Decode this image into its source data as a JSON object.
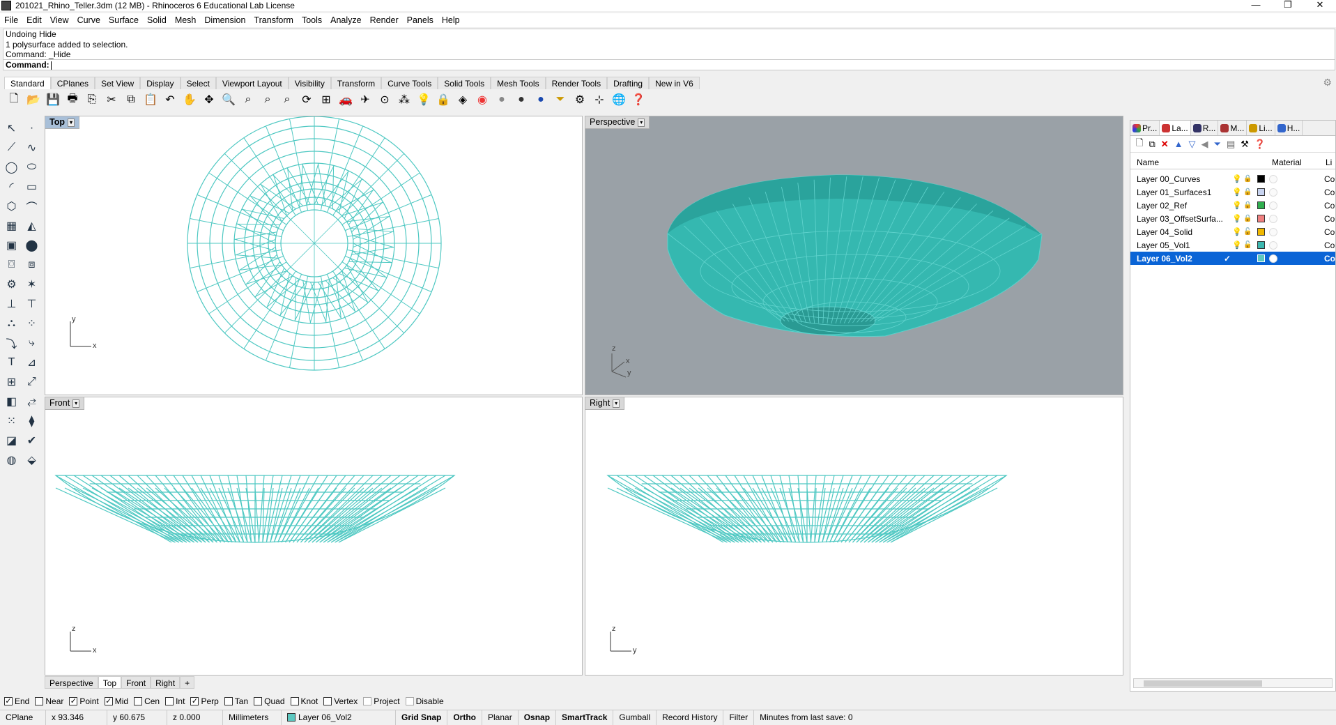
{
  "window": {
    "title": "201021_Rhino_Teller.3dm (12 MB) - Rhinoceros 6 Educational Lab License",
    "buttons": [
      "—",
      "❐",
      "✕"
    ]
  },
  "menu": [
    "File",
    "Edit",
    "View",
    "Curve",
    "Surface",
    "Solid",
    "Mesh",
    "Dimension",
    "Transform",
    "Tools",
    "Analyze",
    "Render",
    "Panels",
    "Help"
  ],
  "command": {
    "history": [
      "Undoing Hide",
      "1 polysurface added to selection.",
      "Command: _Hide"
    ],
    "prompt": "Command:"
  },
  "toolbar_tabs": [
    "Standard",
    "CPlanes",
    "Set View",
    "Display",
    "Select",
    "Viewport Layout",
    "Visibility",
    "Transform",
    "Curve Tools",
    "Solid Tools",
    "Mesh Tools",
    "Render Tools",
    "Drafting",
    "New in V6"
  ],
  "toolbar_icons": [
    "new-file-icon",
    "open-file-icon",
    "save-icon",
    "print-icon",
    "import-icon",
    "cut-icon",
    "copy-icon",
    "paste-icon",
    "undo-icon",
    "pan-icon",
    "rotate-view-icon",
    "zoom-icon",
    "zoom-window-icon",
    "zoom-extents-icon",
    "zoom-selected-icon",
    "rotate-icon",
    "four-viewports-icon",
    "car-icon",
    "plane-icon",
    "point-icon",
    "object-snap-icon",
    "light-icon",
    "lock-icon",
    "material-icon",
    "color-wheel-icon",
    "shade-icon",
    "render-icon",
    "sphere-icon",
    "filter-icon",
    "gear-icon",
    "grid-icon",
    "globe-icon",
    "help-icon"
  ],
  "viewports": {
    "top": {
      "label": "Top",
      "axis_a": "y",
      "axis_b": "x"
    },
    "perspective": {
      "label": "Perspective",
      "axis_a": "z",
      "axis_b": "x",
      "axis_c": "y"
    },
    "front": {
      "label": "Front",
      "axis_a": "z",
      "axis_b": "x"
    },
    "right": {
      "label": "Right",
      "axis_a": "z",
      "axis_b": "y"
    }
  },
  "viewport_tabs": [
    "Perspective",
    "Top",
    "Front",
    "Right",
    "+"
  ],
  "osnap": [
    {
      "label": "End",
      "checked": true
    },
    {
      "label": "Near",
      "checked": false
    },
    {
      "label": "Point",
      "checked": true
    },
    {
      "label": "Mid",
      "checked": true
    },
    {
      "label": "Cen",
      "checked": false
    },
    {
      "label": "Int",
      "checked": false
    },
    {
      "label": "Perp",
      "checked": true
    },
    {
      "label": "Tan",
      "checked": false
    },
    {
      "label": "Quad",
      "checked": false
    },
    {
      "label": "Knot",
      "checked": false
    },
    {
      "label": "Vertex",
      "checked": false
    },
    {
      "label": "Project",
      "checked": false
    },
    {
      "label": "Disable",
      "checked": false
    }
  ],
  "status": {
    "cplane": "CPlane",
    "x": "x 93.346",
    "y": "y 60.675",
    "z": "z 0.000",
    "units": "Millimeters",
    "layer": "Layer 06_Vol2",
    "grid_snap": "Grid Snap",
    "ortho": "Ortho",
    "planar": "Planar",
    "osnap": "Osnap",
    "smarttrack": "SmartTrack",
    "gumball": "Gumball",
    "record_history": "Record History",
    "filter": "Filter",
    "save_info": "Minutes from last save: 0"
  },
  "panel": {
    "tabs": [
      "Pr...",
      "La...",
      "R...",
      "M...",
      "Li...",
      "H..."
    ],
    "col_name": "Name",
    "col_material": "Material",
    "col_linetype": "Li",
    "layers": [
      {
        "name": "Layer 00_Curves",
        "color": "#000000",
        "linetype": "Co",
        "selected": false
      },
      {
        "name": "Layer 01_Surfaces1",
        "color": "#c8d4f0",
        "linetype": "Co",
        "selected": false
      },
      {
        "name": "Layer 02_Ref",
        "color": "#2fae4e",
        "linetype": "Co",
        "selected": false
      },
      {
        "name": "Layer 03_OffsetSurfa...",
        "color": "#f08080",
        "linetype": "Co",
        "selected": false
      },
      {
        "name": "Layer 04_Solid",
        "color": "#f0b800",
        "linetype": "Co",
        "selected": false
      },
      {
        "name": "Layer 05_Vol1",
        "color": "#3cb8b0",
        "linetype": "Co",
        "selected": false
      },
      {
        "name": "Layer 06_Vol2",
        "color": "#5cc8c0",
        "linetype": "Co",
        "selected": true
      }
    ]
  },
  "colors": {
    "wire": "#4ec8c2",
    "selection": "#0a64d6"
  }
}
